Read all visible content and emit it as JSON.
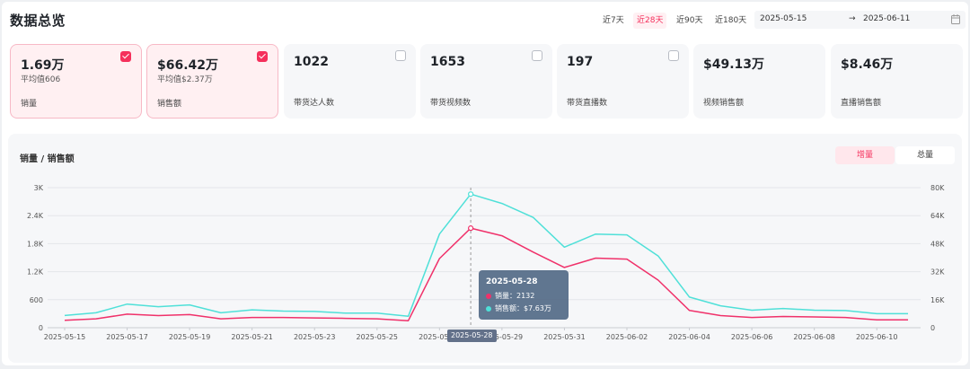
{
  "header": {
    "title": "数据总览",
    "ranges": [
      "近7天",
      "近28天",
      "近90天",
      "近180天"
    ],
    "active_range": "近28天",
    "start_date": "2025-05-15",
    "arrow": "→",
    "end_date": "2025-06-11"
  },
  "cards": [
    {
      "value": "1.69万",
      "avg": "平均值606",
      "label": "销量",
      "selected": true,
      "checkbox": "checked"
    },
    {
      "value": "$66.42万",
      "avg": "平均值$2.37万",
      "label": "销售额",
      "selected": true,
      "checkbox": "checked"
    },
    {
      "value": "1022",
      "avg": "",
      "label": "带货达人数",
      "selected": false,
      "checkbox": "unchecked"
    },
    {
      "value": "1653",
      "avg": "",
      "label": "带货视频数",
      "selected": false,
      "checkbox": "unchecked"
    },
    {
      "value": "197",
      "avg": "",
      "label": "带货直播数",
      "selected": false,
      "checkbox": "unchecked"
    },
    {
      "value": "$49.13万",
      "avg": "",
      "label": "视频销售额",
      "selected": false,
      "checkbox": "none"
    },
    {
      "value": "$8.46万",
      "avg": "",
      "label": "直播销售额",
      "selected": false,
      "checkbox": "none"
    }
  ],
  "chart": {
    "title": "销量 / 销售额",
    "toggle_increment": "增量",
    "toggle_total": "总量",
    "tooltip": {
      "date": "2025-05-28",
      "sales_label": "销量：2132",
      "revenue_label": "销售额：$7.63万"
    },
    "hover_x_label": "2025-05-28"
  },
  "colors": {
    "accent": "#f5305c",
    "sales_line": "#f0316a",
    "revenue_line": "#4fe0d8"
  },
  "chart_data": {
    "type": "line",
    "x": [
      "2025-05-15",
      "2025-05-16",
      "2025-05-17",
      "2025-05-18",
      "2025-05-19",
      "2025-05-20",
      "2025-05-21",
      "2025-05-22",
      "2025-05-23",
      "2025-05-24",
      "2025-05-25",
      "2025-05-26",
      "2025-05-27",
      "2025-05-28",
      "2025-05-29",
      "2025-05-30",
      "2025-05-31",
      "2025-06-01",
      "2025-06-02",
      "2025-06-03",
      "2025-06-04",
      "2025-06-05",
      "2025-06-06",
      "2025-06-07",
      "2025-06-08",
      "2025-06-09",
      "2025-06-10",
      "2025-06-11"
    ],
    "x_tick_labels": [
      "2025-05-15",
      "2025-05-17",
      "2025-05-19",
      "2025-05-21",
      "2025-05-23",
      "2025-05-25",
      "2025-05-27",
      "2025-05-29",
      "2025-05-31",
      "2025-06-02",
      "2025-06-04",
      "2025-06-06",
      "2025-06-08",
      "2025-06-10"
    ],
    "y_left_ticks": [
      "0",
      "600",
      "1.2K",
      "1.8K",
      "2.4K",
      "3K"
    ],
    "y_right_ticks": [
      "0",
      "16K",
      "32K",
      "48K",
      "64K",
      "80K"
    ],
    "ylim_left": [
      0,
      3000
    ],
    "ylim_right": [
      0,
      80000
    ],
    "series": [
      {
        "name": "销量",
        "axis": "left",
        "values": [
          160,
          190,
          290,
          260,
          280,
          190,
          220,
          220,
          210,
          200,
          190,
          150,
          1480,
          2132,
          1970,
          1620,
          1290,
          1490,
          1470,
          1020,
          370,
          260,
          220,
          240,
          230,
          220,
          170,
          170
        ]
      },
      {
        "name": "销售额",
        "axis": "right",
        "values": [
          7000,
          8500,
          13500,
          12000,
          13000,
          8500,
          10200,
          9500,
          9300,
          8300,
          8300,
          6500,
          53500,
          76300,
          71000,
          63000,
          46000,
          53500,
          53000,
          41000,
          17500,
          12500,
          10000,
          11000,
          10000,
          9800,
          8000,
          8000
        ]
      }
    ],
    "grid": true
  }
}
